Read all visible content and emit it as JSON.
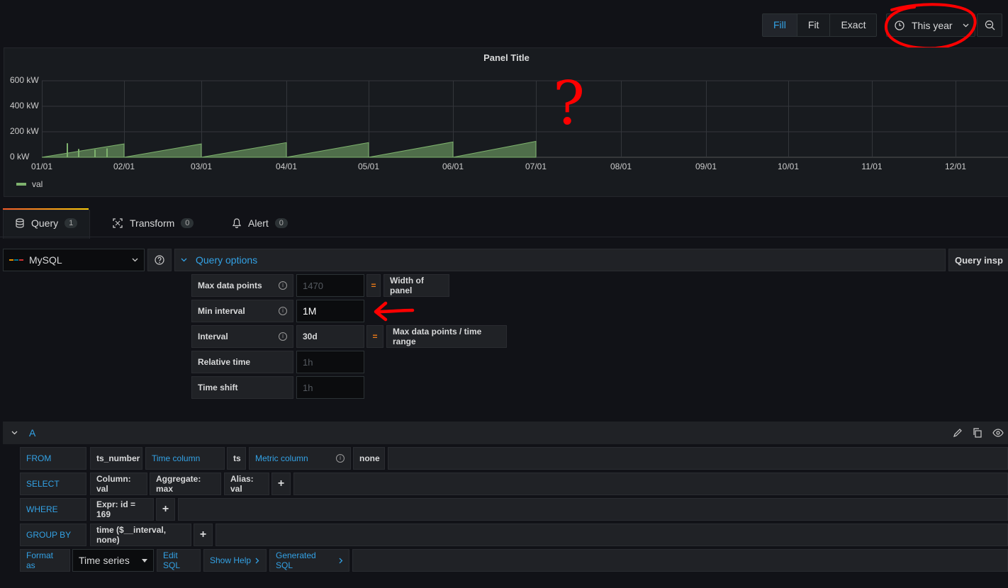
{
  "toolbar": {
    "fill": "Fill",
    "fit": "Fit",
    "exact": "Exact",
    "time_range": "This year"
  },
  "panel": {
    "title": "Panel Title",
    "legend": "val",
    "series_color": "#7eb26d"
  },
  "chart_data": {
    "type": "area",
    "y_ticks": [
      "600 kW",
      "400 kW",
      "200 kW",
      "0 kW"
    ],
    "x_ticks": [
      "01/01",
      "02/01",
      "03/01",
      "04/01",
      "05/01",
      "06/01",
      "07/01",
      "08/01",
      "09/01",
      "10/01",
      "11/01",
      "12/01"
    ],
    "ylim": [
      0,
      600
    ],
    "series": [
      {
        "name": "val",
        "color": "#7eb26d",
        "monthly_sawtooth": [
          {
            "start": "01/01",
            "end": "02/01",
            "from": 0,
            "to": 105
          },
          {
            "start": "02/01",
            "end": "03/01",
            "from": 0,
            "to": 105
          },
          {
            "start": "03/01",
            "end": "04/01",
            "from": 0,
            "to": 115
          },
          {
            "start": "04/01",
            "end": "05/01",
            "from": 0,
            "to": 115
          },
          {
            "start": "05/01",
            "end": "06/01",
            "from": 0,
            "to": 120
          },
          {
            "start": "06/01",
            "end": "07/01",
            "from": 0,
            "to": 125
          }
        ]
      }
    ],
    "grid": true
  },
  "tabs": [
    {
      "label": "Query",
      "count": "1"
    },
    {
      "label": "Transform",
      "count": "0"
    },
    {
      "label": "Alert",
      "count": "0"
    }
  ],
  "datasource": {
    "name": "MySQL"
  },
  "query_options": {
    "title": "Query options",
    "inspector": "Query insp",
    "max_data_points": {
      "label": "Max data points",
      "placeholder": "1470",
      "eq": "=",
      "note": "Width of panel"
    },
    "min_interval": {
      "label": "Min interval",
      "value": "1M"
    },
    "interval": {
      "label": "Interval",
      "value": "30d",
      "eq": "=",
      "note": "Max data points / time range"
    },
    "relative_time": {
      "label": "Relative time",
      "placeholder": "1h"
    },
    "time_shift": {
      "label": "Time shift",
      "placeholder": "1h"
    }
  },
  "query": {
    "ref_id": "A",
    "from": {
      "kw": "FROM",
      "table": "ts_number",
      "time_label": "Time column",
      "time_value": "ts",
      "metric_label": "Metric column",
      "metric_value": "none"
    },
    "select": {
      "kw": "SELECT",
      "column": "Column: val",
      "aggregate": "Aggregate: max",
      "alias": "Alias: val",
      "plus": "+"
    },
    "where": {
      "kw": "WHERE",
      "expr": "Expr: id = 169",
      "plus": "+"
    },
    "group_by": {
      "kw": "GROUP BY",
      "expr": "time ($__interval, none)",
      "plus": "+"
    },
    "format": {
      "kw": "Format as",
      "value": "Time series",
      "edit_sql": "Edit SQL",
      "show_help": "Show Help",
      "generated_sql": "Generated SQL"
    }
  },
  "annotations": {
    "question_mark": "?",
    "color": "#ff0000"
  }
}
